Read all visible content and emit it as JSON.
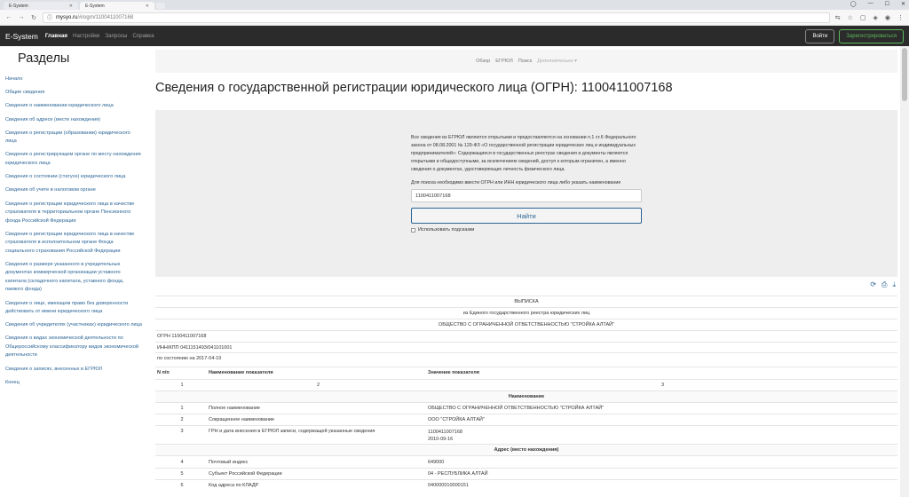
{
  "browser": {
    "tabs": [
      {
        "title": "E-System"
      },
      {
        "title": "E-System"
      }
    ],
    "url_host": "mysyo.ru",
    "url_path": "/#/ogrn/1100411007168"
  },
  "navbar": {
    "brand": "E-System",
    "links": [
      "Главная",
      "Настройки",
      "Запросы",
      "Справка"
    ],
    "login": "Войти",
    "register": "Зарегистрироваться"
  },
  "sidebar": {
    "title": "Разделы",
    "items": [
      "Начало",
      "Общие сведения",
      "Сведения о наименовании юридического лица",
      "Сведения об адресе (месте нахождения)",
      "Сведения о регистрации (образовании) юридического лица",
      "Сведения о регистрирующем органе по месту нахождения юридического лица",
      "Сведения о состоянии (статусе) юридического лица",
      "Сведения об учете в налоговом органе",
      "Сведения о регистрации юридического лица в качестве страхователя в территориальном органе Пенсионного фонда Российской Федерации",
      "Сведения о регистрации юридического лица в качестве страхователя в исполнительном органе Фонда социального страхования Российской Федерации",
      "Сведения о размере указанного в учредительных документах коммерческой организации уставного капитала (складочного капитала, уставного фонда, паевого фонда)",
      "Сведения о лице, имеющем право без доверенности действовать от имени юридического лица",
      "Сведения об учредителях (участниках) юридического лица",
      "Сведения о видах экономической деятельности по Общероссийскому классификатору видов экономической деятельности",
      "Сведения о записях, внесенных в ЕГРЮЛ",
      "Конец"
    ]
  },
  "subnav": {
    "items": [
      "Обзор",
      "ЕГРЮЛ",
      "Поиск"
    ],
    "more": "Дополнительно ▾"
  },
  "page_title": "Сведения о государственной регистрации юридического лица (ОГРН): 1100411007168",
  "search": {
    "info": "Все сведения из ЕГРЮЛ являются открытыми и предоставляются на основании п.1 ст.6 Федерального закона от 08.08.2001 № 129-ФЗ «О государственной регистрации юридических лиц и индивидуальных предпринимателей»: Содержащиеся в государственных реестрах сведения и документы являются открытыми и общедоступными, за исключением сведений, доступ к которым ограничен, а именно сведения о документах, удостоверяющих личность физического лица.",
    "hint": "Для поиска необходимо ввести ОГРН или ИНН юридического лица либо указать наименование",
    "input_value": "1100411007168",
    "button": "Найти",
    "use_hints": "Использовать подсказки"
  },
  "extract": {
    "title": "ВЫПИСКА",
    "subtitle": "из Единого государственного реестра юридических лиц",
    "company": "ОБЩЕСТВО С ОГРАНИЧЕННОЙ ОТВЕТСТВЕННОСТЬЮ \"СТРОЙКА АЛТАЙ\"",
    "ogrn": "ОГРН 1100411007168",
    "inn_kpp": "ИНН/КПП 0411151493/041101001",
    "as_of": "по состоянию на 2017-04-19",
    "headers": [
      "N п/п",
      "Наименование показателя",
      "Значение показателя"
    ],
    "numbering": [
      "1",
      "2",
      "3"
    ],
    "section_name": "Наименование",
    "rows_name": [
      {
        "n": "1",
        "label": "Полное наименование",
        "value": "ОБЩЕСТВО С ОГРАНИЧЕННОЙ ОТВЕТСТВЕННОСТЬЮ \"СТРОЙКА АЛТАЙ\""
      },
      {
        "n": "2",
        "label": "Сокращенное наименование",
        "value": "ООО \"СТРОЙКА АЛТАЙ\""
      },
      {
        "n": "3",
        "label": "ГРН и дата внесения в ЕГРЮЛ записи, содержащей указанные сведения",
        "value1": "1100411007168",
        "value2": "2010-09-16"
      }
    ],
    "section_address": "Адрес (место нахождения)",
    "rows_address": [
      {
        "n": "4",
        "label": "Почтовый индекс",
        "value": "649000"
      },
      {
        "n": "5",
        "label": "Субъект Российской Федерации",
        "value": "04 - РЕСПУБЛИКА АЛТАЙ"
      },
      {
        "n": "6",
        "label": "Код адреса по КЛАДР",
        "value": "040000010000151"
      }
    ]
  },
  "icons": {
    "refresh": "refresh-icon",
    "print": "print-icon",
    "download": "download-icon"
  }
}
